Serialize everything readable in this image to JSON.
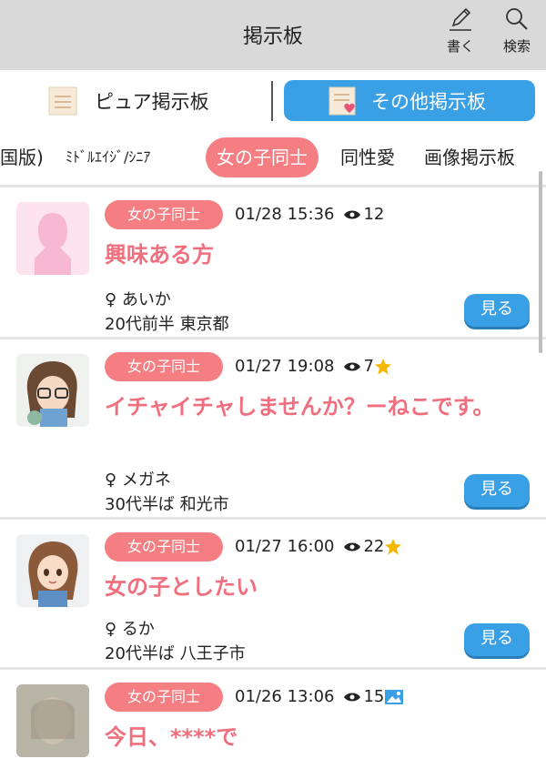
{
  "header": {
    "title": "掲示板",
    "write_label": "書く",
    "search_label": "検索"
  },
  "board_switch": {
    "pure_label": "ピュア掲示板",
    "other_label": "その他掲示板"
  },
  "category_tabs": [
    {
      "label": "国版)"
    },
    {
      "label": "ﾐﾄﾞﾙｴｲｼﾞ/ｼﾆｱ"
    },
    {
      "label": "女の子同士"
    },
    {
      "label": "同性愛"
    },
    {
      "label": "画像掲示板"
    }
  ],
  "posts": [
    {
      "category": "女の子同士",
      "datetime": "01/28 15:36",
      "views": "12",
      "title": "興味ある方",
      "username": "あいか",
      "gender_symbol": "♀",
      "profile": "20代前半 東京都",
      "view_button": "見る",
      "extra_icon": "",
      "avatar": "silhouette-placeholder"
    },
    {
      "category": "女の子同士",
      "datetime": "01/27 19:08",
      "views": "7",
      "title": "イチャイチャしませんか？ーねこです。",
      "username": "メガネ",
      "gender_symbol": "♀",
      "profile": "30代半ば 和光市",
      "view_button": "見る",
      "extra_icon": "star-icon",
      "avatar": "anime-glasses-girl"
    },
    {
      "category": "女の子同士",
      "datetime": "01/27 16:00",
      "views": "22",
      "title": "女の子としたい",
      "username": "るか",
      "gender_symbol": "♀",
      "profile": "20代半ば 八王子市",
      "view_button": "見る",
      "extra_icon": "star-icon",
      "avatar": "anime-brown-hair-girl"
    },
    {
      "category": "女の子同士",
      "datetime": "01/26 13:06",
      "views": "15",
      "title": "今日、****で",
      "username": "",
      "gender_symbol": "",
      "profile": "",
      "view_button": "",
      "extra_icon": "image-icon",
      "avatar": "blurred-photo"
    }
  ],
  "colors": {
    "accent_blue": "#3aa0e6",
    "accent_pink": "#f47e82",
    "title_pink": "#f06f7e",
    "star_yellow": "#f5b800"
  }
}
